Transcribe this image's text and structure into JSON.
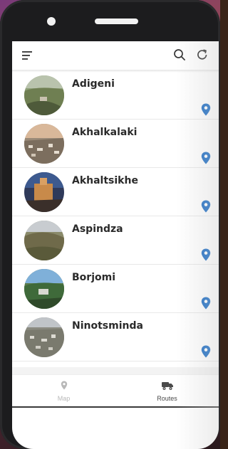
{
  "toolbar": {
    "menu_icon": "menu-icon",
    "search_icon": "search-icon",
    "refresh_icon": "refresh-icon"
  },
  "locations": [
    {
      "name": "Adigeni"
    },
    {
      "name": "Akhalkalaki"
    },
    {
      "name": "Akhaltsikhe"
    },
    {
      "name": "Aspindza"
    },
    {
      "name": "Borjomi"
    },
    {
      "name": "Ninotsminda"
    }
  ],
  "tabs": {
    "map_label": "Map",
    "routes_label": "Routes"
  },
  "colors": {
    "pin": "#1f6fc5",
    "title_text": "#2a2a2a",
    "inactive_tab": "#b8b8b8",
    "active_tab": "#4a4a4a"
  }
}
